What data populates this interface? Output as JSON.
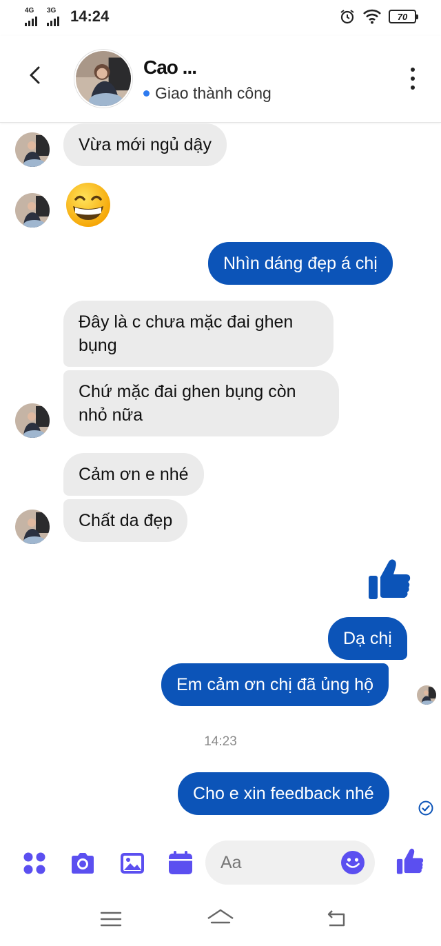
{
  "status_bar": {
    "sim1_network": "4G",
    "sim2_network": "3G",
    "time": "14:24",
    "battery": "70"
  },
  "header": {
    "contact_name": "Cao ...",
    "status": "Giao thành công"
  },
  "messages": [
    {
      "side": "in",
      "text": "Vừa mới ngủ dậy"
    },
    {
      "side": "in",
      "type": "emoji",
      "text": "😁"
    },
    {
      "side": "out",
      "text": "Nhìn dáng đẹp á chị"
    },
    {
      "side": "in",
      "text": "Đây là c chưa mặc đai ghen bụng"
    },
    {
      "side": "in",
      "text": "Chứ mặc đai ghen bụng còn nhỏ nữa"
    },
    {
      "side": "in",
      "text": "Cảm ơn e nhé"
    },
    {
      "side": "in",
      "text": "Chất da đẹp"
    },
    {
      "side": "out",
      "type": "like",
      "icon": "thumbs-up-icon"
    },
    {
      "side": "out",
      "text": "Dạ chị"
    },
    {
      "side": "out",
      "text": "Em cảm ơn chị đã ủng hộ"
    },
    {
      "side": "out",
      "text": "Cho e xin feedback nhé"
    }
  ],
  "timestamp": "14:23",
  "composer": {
    "placeholder": "Aa",
    "icons": [
      "apps-icon",
      "camera-icon",
      "gallery-icon",
      "calendar-icon",
      "emoji-icon",
      "thumbs-up-icon"
    ]
  },
  "colors": {
    "accent": "#5b4ff0",
    "outgoing_bubble": "#0c54b8",
    "incoming_bubble": "#ebebeb",
    "like": "#0c54b8"
  }
}
